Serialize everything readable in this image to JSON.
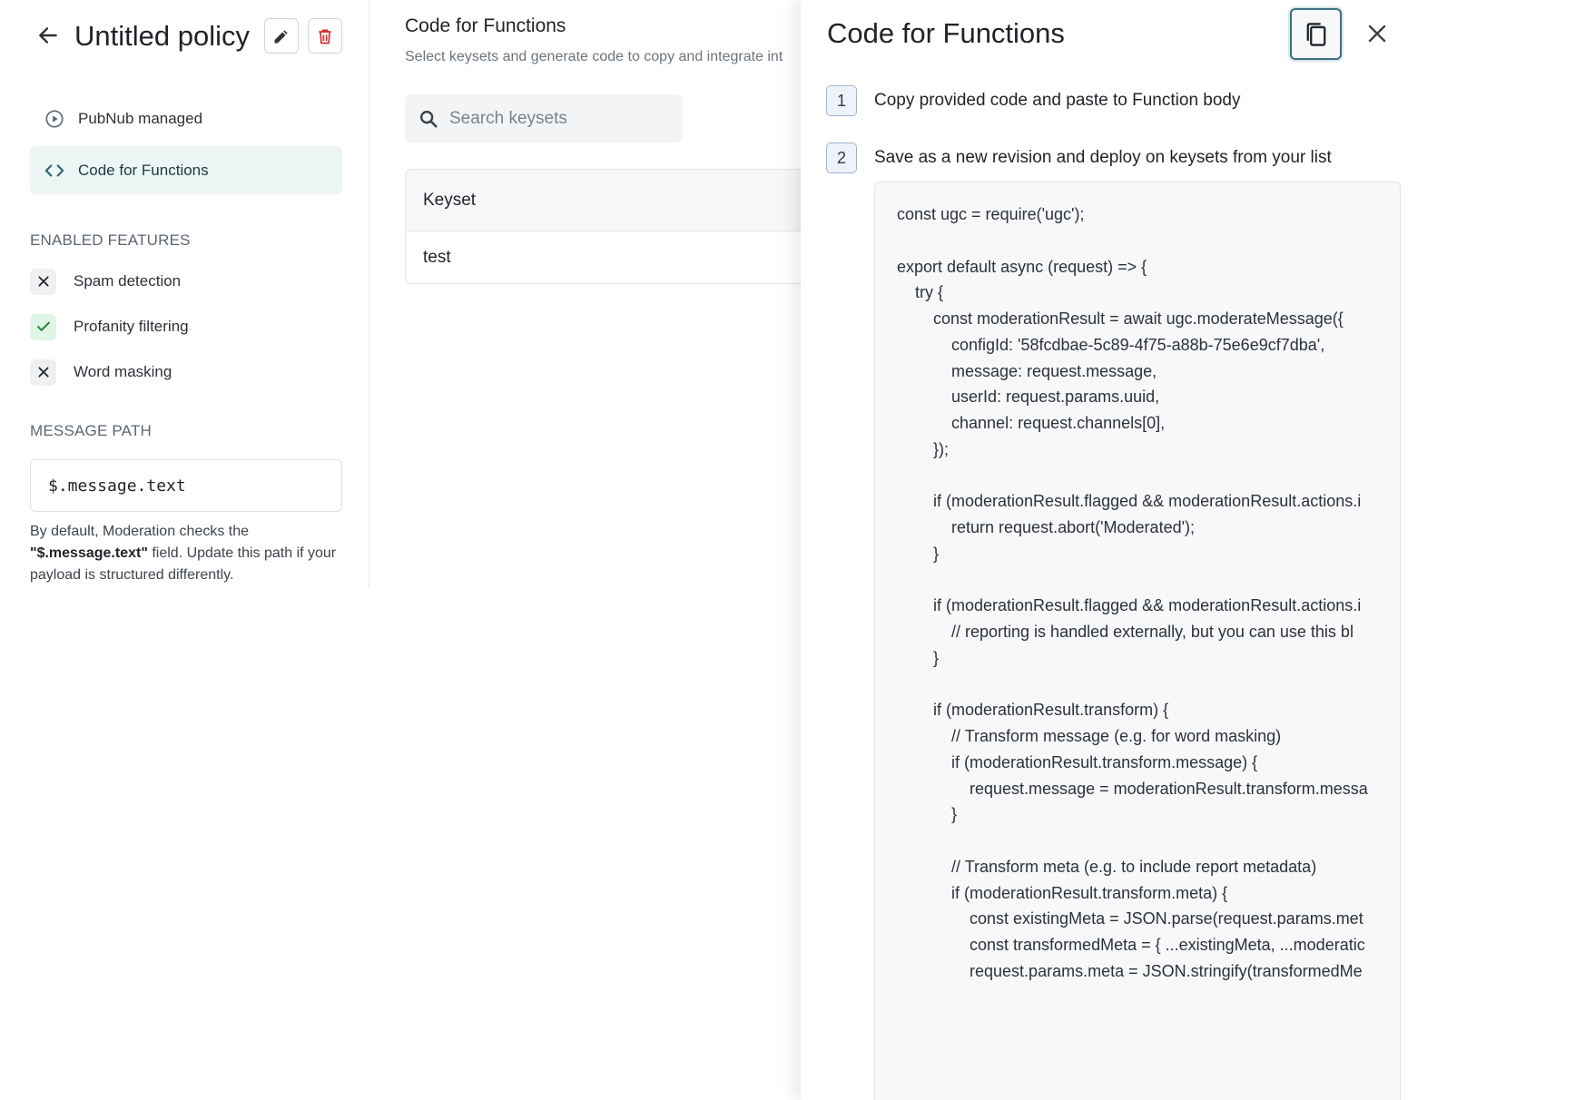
{
  "header": {
    "title": "Untitled policy"
  },
  "sidebar": {
    "nav": [
      {
        "label": "PubNub managed",
        "icon": "play-circle-icon"
      },
      {
        "label": "Code for Functions",
        "icon": "code-icon",
        "active": true
      }
    ],
    "features_heading": "ENABLED FEATURES",
    "features": [
      {
        "label": "Spam detection",
        "enabled": false
      },
      {
        "label": "Profanity filtering",
        "enabled": true
      },
      {
        "label": "Word masking",
        "enabled": false
      }
    ],
    "message_path_heading": "MESSAGE PATH",
    "message_path_value": "$.message.text",
    "help_prefix": "By default, Moderation checks the ",
    "help_bold": "\"$.message.text\"",
    "help_suffix": " field. Update this path if your payload is structured differently."
  },
  "main": {
    "title": "Code for Functions",
    "subtitle": "Select keysets and generate code to copy and integrate int",
    "search_placeholder": "Search keysets",
    "table_header": "Keyset",
    "rows": [
      "test"
    ]
  },
  "drawer": {
    "title": "Code for Functions",
    "steps": [
      {
        "number": "1",
        "text": "Copy provided code and paste to Function body"
      },
      {
        "number": "2",
        "text": "Save as a new revision and deploy on keysets from your list"
      }
    ],
    "code": "const ugc = require('ugc');\n\nexport default async (request) => {\n    try {\n        const moderationResult = await ugc.moderateMessage({\n            configId: '58fcdbae-5c89-4f75-a88b-75e6e9cf7dba',\n            message: request.message,\n            userId: request.params.uuid,\n            channel: request.channels[0],\n        });\n\n        if (moderationResult.flagged && moderationResult.actions.i\n            return request.abort('Moderated');\n        }\n\n        if (moderationResult.flagged && moderationResult.actions.i\n            // reporting is handled externally, but you can use this bl\n        }\n\n        if (moderationResult.transform) {\n            // Transform message (e.g. for word masking)\n            if (moderationResult.transform.message) {\n                request.message = moderationResult.transform.messa\n            }\n\n            // Transform meta (e.g. to include report metadata)\n            if (moderationResult.transform.meta) {\n                const existingMeta = JSON.parse(request.params.met\n                const transformedMeta = { ...existingMeta, ...moderatic\n                request.params.meta = JSON.stringify(transformedMe"
  },
  "colors": {
    "accent": "#3e6f7e",
    "active_nav_bg": "#edf5f5",
    "delete_red": "#d32f2f",
    "enabled_green": "#1f8a3a"
  }
}
